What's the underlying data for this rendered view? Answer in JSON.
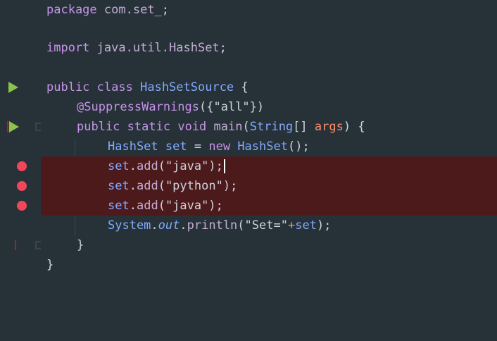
{
  "editor": {
    "lines": [
      {
        "kind": "package",
        "kw": "package",
        "name": "com.set_",
        "end": ";"
      },
      {
        "kind": "blank"
      },
      {
        "kind": "import",
        "kw": "import",
        "name": "java.util.HashSet",
        "end": ";"
      },
      {
        "kind": "blank"
      },
      {
        "kind": "class",
        "kw1": "public",
        "kw2": "class",
        "name": "HashSetSource",
        "end": " {"
      },
      {
        "kind": "annotation",
        "ann": "@SuppressWarnings",
        "open": "({",
        "str": "\"all\"",
        "close": "})"
      },
      {
        "kind": "method",
        "kw1": "public",
        "kw2": "static",
        "kw3": "void",
        "name": "main",
        "open": "(",
        "type": "String",
        "arr": "[] ",
        "param": "args",
        "close": ") {"
      },
      {
        "kind": "decl",
        "type": "HashSet",
        "var": "set",
        "eq": " = ",
        "kw": "new",
        "ctor": "HashSet",
        "end": "();"
      },
      {
        "kind": "call",
        "var": "set",
        "dot": ".",
        "fn": "add",
        "open": "(",
        "str": "\"java\"",
        "close": ");",
        "caret": true
      },
      {
        "kind": "call",
        "var": "set",
        "dot": ".",
        "fn": "add",
        "open": "(",
        "str": "\"python\"",
        "close": ");"
      },
      {
        "kind": "call",
        "var": "set",
        "dot": ".",
        "fn": "add",
        "open": "(",
        "str": "\"java\"",
        "close": ");"
      },
      {
        "kind": "println",
        "cls": "System",
        "dot1": ".",
        "field": "out",
        "dot2": ".",
        "fn": "println",
        "open": "(",
        "str": "\"Set=\"",
        "op": "+",
        "var": "set",
        "close": ");"
      },
      {
        "kind": "brace",
        "text": "}"
      },
      {
        "kind": "brace",
        "text": "}"
      }
    ],
    "gutter": {
      "run_icon": "run-triangle-icon",
      "breakpoint_icon": "breakpoint-icon",
      "fold_icon": "fold-marker-icon"
    },
    "colors": {
      "background": "#263238",
      "breakpoint_line": "#4d1a1c",
      "breakpoint_dot": "#f0465a",
      "run_icon": "#8bc34a"
    }
  }
}
